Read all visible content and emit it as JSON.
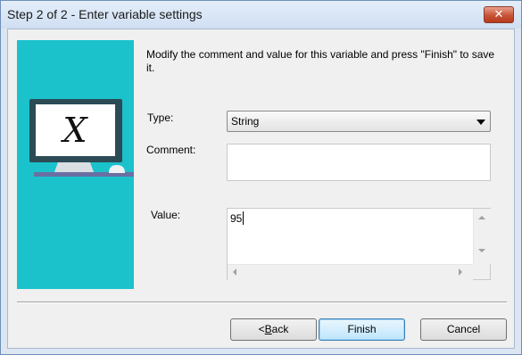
{
  "window": {
    "title": "Step 2 of 2 - Enter variable settings",
    "close_icon": "close-icon",
    "close_glyph": "✕"
  },
  "side_panel": {
    "illustration": "monitor-icon",
    "monitor_glyph": "X",
    "background_color": "#1bc2cc"
  },
  "form": {
    "instructions": "Modify the comment and value for this variable and press \"Finish\" to save it.",
    "type_label": "Type:",
    "type_value": "String",
    "comment_label": "Comment:",
    "comment_value": "",
    "value_label": "Value:",
    "value_value": "95"
  },
  "buttons": {
    "back_prefix": "<",
    "back_underlined": "B",
    "back_rest": "ack",
    "finish": "Finish",
    "cancel": "Cancel"
  }
}
